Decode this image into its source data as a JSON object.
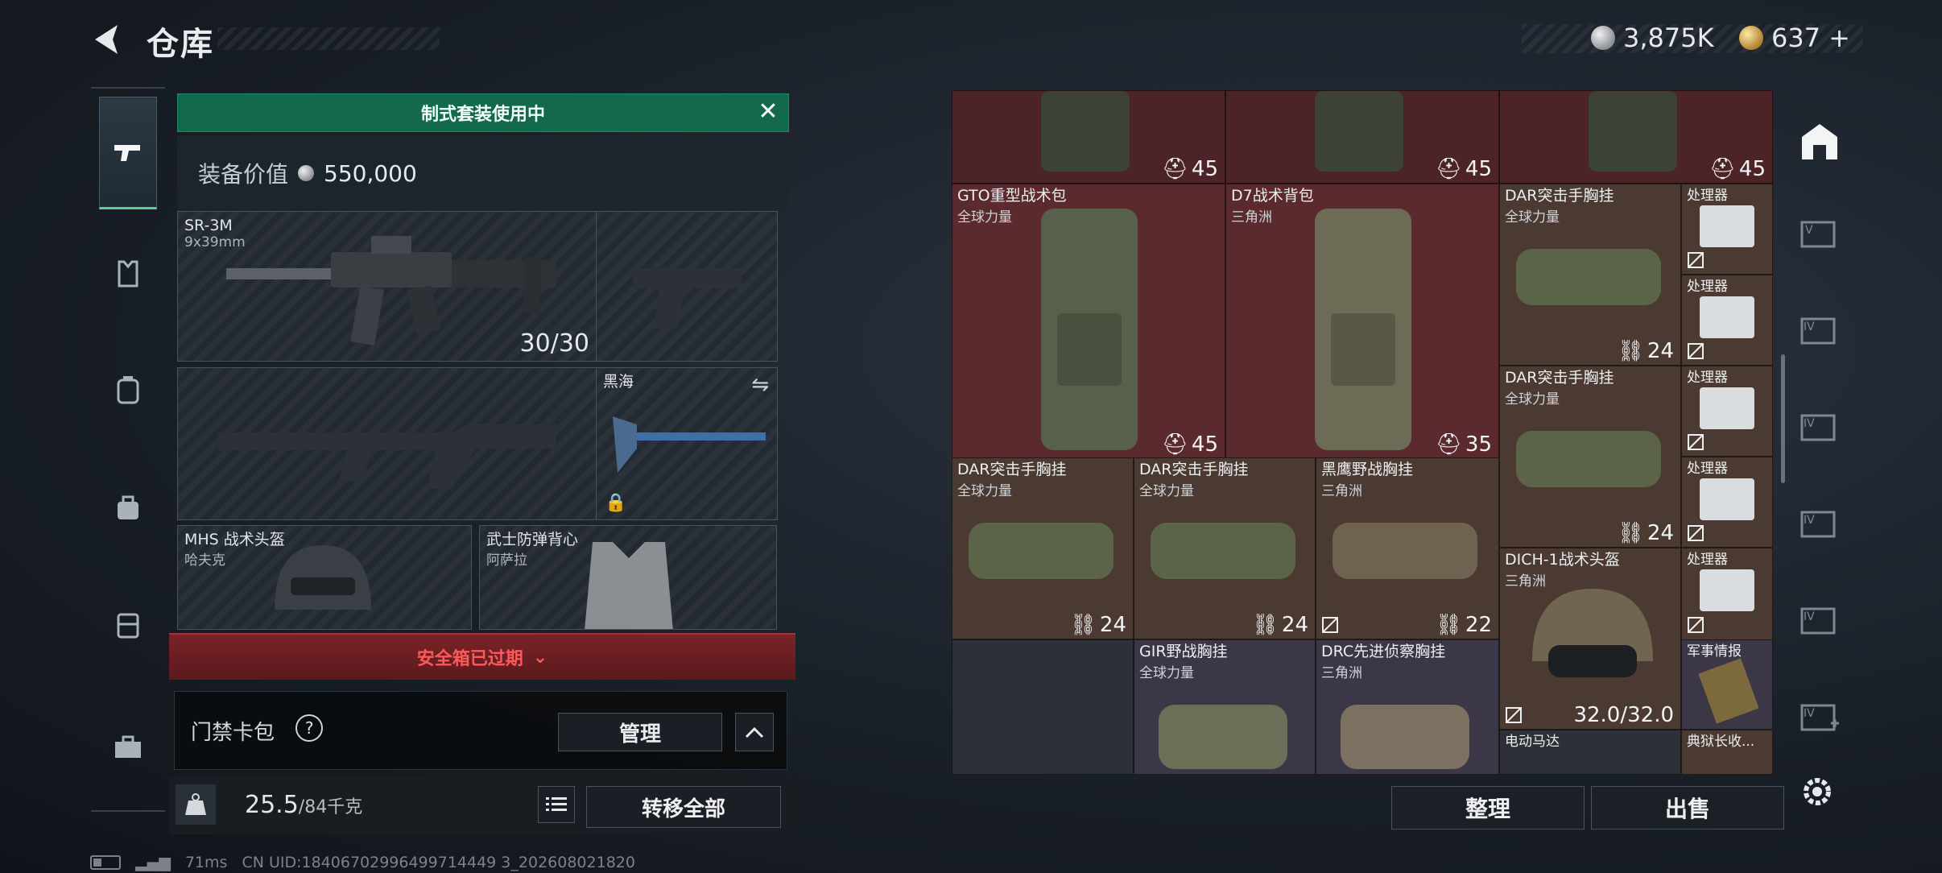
{
  "header": {
    "title": "仓库",
    "currency_silver": "3,875K",
    "currency_gold": "637",
    "plus": "+"
  },
  "left_nav": [
    "pistol-icon",
    "vest-icon",
    "backpack-icon",
    "pouch-icon",
    "case-icon",
    "toolbox-icon"
  ],
  "loadout": {
    "banner": "制式套装使用中",
    "equip_value_label": "装备价值",
    "equip_value": "550,000",
    "primary_weapon": {
      "name": "SR-3M",
      "ammo": "9x39mm",
      "count": "30/30"
    },
    "melee": {
      "name": "黑海"
    },
    "helmet": {
      "name": "MHS 战术头盔",
      "map": "哈夫克"
    },
    "armor": {
      "name": "武士防弹背心",
      "map": "阿萨拉"
    },
    "safebox_status": "安全箱已过期",
    "access_card_label": "门禁卡包",
    "help": "?",
    "manage_label": "管理",
    "weight_current": "25.5",
    "weight_max": "/84千克",
    "transfer_all_label": "转移全部"
  },
  "stash": {
    "items": [
      {
        "name": "",
        "sub": "",
        "count": "45"
      },
      {
        "name": "",
        "sub": "",
        "count": "45"
      },
      {
        "name": "",
        "sub": "",
        "count": "45"
      },
      {
        "name": "GTO重型战术包",
        "sub": "全球力量",
        "count": "45"
      },
      {
        "name": "D7战术背包",
        "sub": "三角洲",
        "count": "35"
      },
      {
        "name": "DAR突击手胸挂",
        "sub": "全球力量",
        "count": "24"
      },
      {
        "name": "处理器",
        "sub": ""
      },
      {
        "name": "处理器",
        "sub": ""
      },
      {
        "name": "DAR突击手胸挂",
        "sub": "全球力量",
        "count": "24"
      },
      {
        "name": "处理器",
        "sub": ""
      },
      {
        "name": "处理器",
        "sub": ""
      },
      {
        "name": "DAR突击手胸挂",
        "sub": "全球力量",
        "count": "24"
      },
      {
        "name": "DAR突击手胸挂",
        "sub": "全球力量",
        "count": "24"
      },
      {
        "name": "黑鹰野战胸挂",
        "sub": "三角洲",
        "count": "22"
      },
      {
        "name": "DICH-1战术头盔",
        "sub": "三角洲",
        "count": "32.0/32.0"
      },
      {
        "name": "处理器",
        "sub": ""
      },
      {
        "name": "GIR野战胸挂",
        "sub": "全球力量"
      },
      {
        "name": "DRC先进侦察胸挂",
        "sub": "三角洲"
      },
      {
        "name": "军事情报",
        "sub": ""
      },
      {
        "name": "电动马达",
        "sub": ""
      },
      {
        "name": "典狱长收...",
        "sub": ""
      }
    ],
    "organize_label": "整理",
    "sell_label": "出售"
  },
  "right_tabs": [
    "stash-home-icon",
    "tab-v-icon",
    "tab-iv-icon",
    "tab-iv-icon",
    "tab-iv-icon",
    "tab-iv-icon",
    "tab-iv-add-icon",
    "settings-icon"
  ],
  "status": {
    "ping": "71ms",
    "uid": "CN UID:18406702996499714449 3_202608021820"
  },
  "colors": {
    "banner_green": "#13694b",
    "expired_red": "#ff5a5a",
    "active_tab": "#4fd3a2"
  }
}
